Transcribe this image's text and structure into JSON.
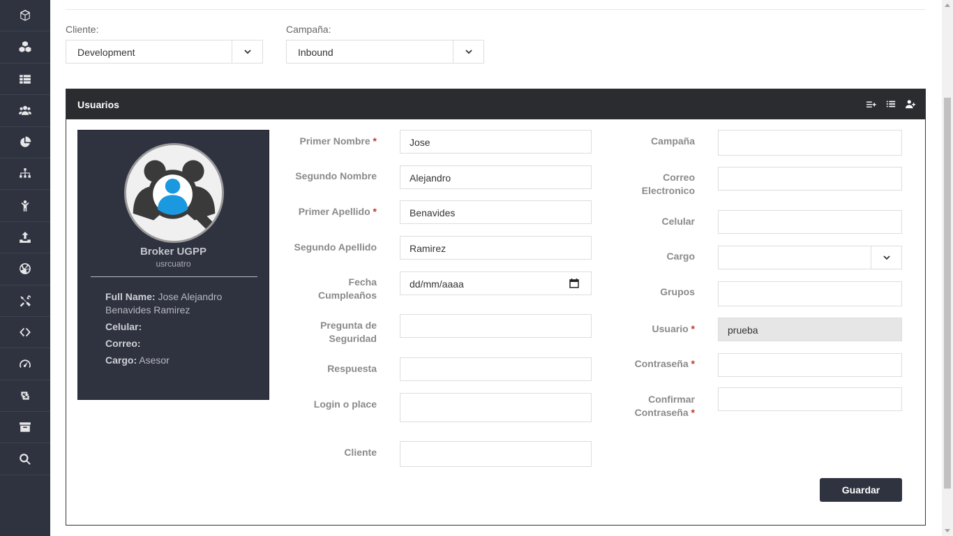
{
  "sidebar": {
    "items": [
      {
        "icon": "cube-icon"
      },
      {
        "icon": "cubes-icon"
      },
      {
        "icon": "th-list-icon"
      },
      {
        "icon": "users-icon"
      },
      {
        "icon": "pie-chart-icon"
      },
      {
        "icon": "sitemap-icon"
      },
      {
        "icon": "child-icon"
      },
      {
        "icon": "upload-icon"
      },
      {
        "icon": "basketball-icon"
      },
      {
        "icon": "tools-icon"
      },
      {
        "icon": "code-icon"
      },
      {
        "icon": "tachometer-icon"
      },
      {
        "icon": "retweet-icon"
      },
      {
        "icon": "archive-icon"
      },
      {
        "icon": "search-icon"
      }
    ]
  },
  "filters": {
    "cliente_label": "Cliente:",
    "cliente_value": "Development",
    "campana_label": "Campaña:",
    "campana_value": "Inbound"
  },
  "panel": {
    "title": "Usuarios",
    "icons": [
      "add-list-icon",
      "list-icon",
      "add-user-icon"
    ]
  },
  "profile": {
    "name": "Broker UGPP",
    "username": "usrcuatro",
    "full_name_label": "Full Name:",
    "full_name_value": "Jose Alejandro Benavides Ramirez",
    "celular_label": "Celular:",
    "celular_value": "",
    "correo_label": "Correo:",
    "correo_value": "",
    "cargo_label": "Cargo:",
    "cargo_value": "Asesor"
  },
  "form_left": {
    "primer_nombre_label": "Primer Nombre",
    "primer_nombre_value": "Jose",
    "segundo_nombre_label": "Segundo Nombre",
    "segundo_nombre_value": "Alejandro",
    "primer_apellido_label": "Primer Apellido",
    "primer_apellido_value": "Benavides",
    "segundo_apellido_label": "Segundo Apellido",
    "segundo_apellido_value": "Ramirez",
    "fecha_label_1": "Fecha",
    "fecha_label_2": "Cumpleaños",
    "fecha_placeholder": "dd/mm/aaaa",
    "pregunta_label_1": "Pregunta de",
    "pregunta_label_2": "Seguridad",
    "pregunta_value": "",
    "respuesta_label": "Respuesta",
    "respuesta_value": "",
    "login_label": "Login o place",
    "login_value": "",
    "cliente_label": "Cliente",
    "cliente_value": ""
  },
  "form_right": {
    "campana_label": "Campaña",
    "campana_value": "",
    "correo_label_1": "Correo",
    "correo_label_2": "Electronico",
    "correo_value": "",
    "celular_label": "Celular",
    "celular_value": "",
    "cargo_label": "Cargo",
    "cargo_value": "",
    "grupos_label": "Grupos",
    "grupos_value": "",
    "usuario_label": "Usuario",
    "usuario_value": "prueba",
    "contrasena_label": "Contraseña",
    "contrasena_value": "",
    "confirmar_label_1": "Confirmar",
    "confirmar_label_2": "Contraseña",
    "confirmar_value": ""
  },
  "actions": {
    "save_label": "Guardar"
  },
  "required_mark": "*"
}
